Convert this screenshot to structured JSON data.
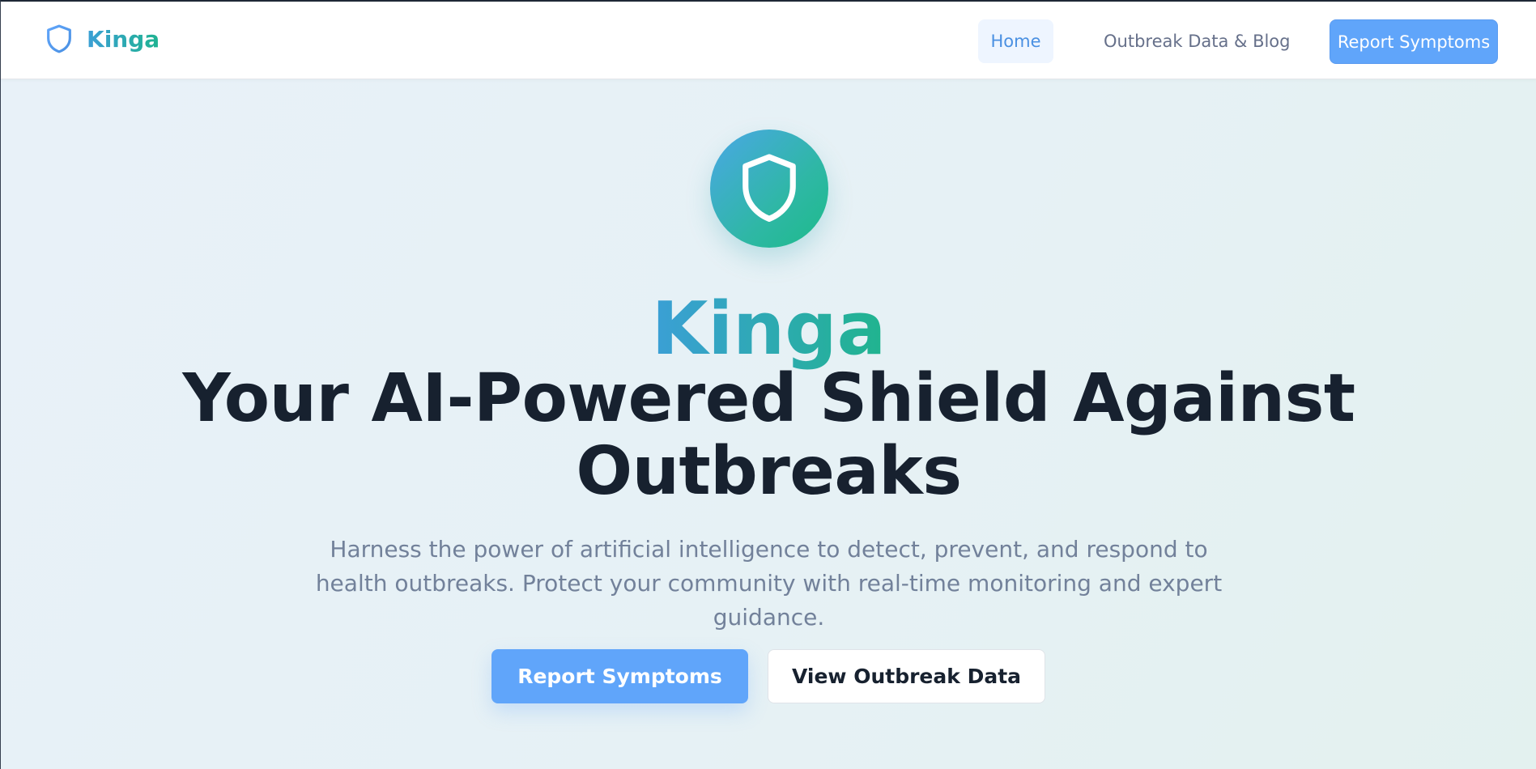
{
  "brand": {
    "name": "Kinga",
    "icon": "shield-icon"
  },
  "nav": {
    "home": "Home",
    "blog": "Outbreak Data & Blog",
    "report": "Report Symptoms"
  },
  "hero": {
    "badge_icon": "shield-icon",
    "brand": "Kinga",
    "title": "Your AI-Powered Shield Against Outbreaks",
    "subtitle": "Harness the power of artificial intelligence to detect, prevent, and respond to health outbreaks. Protect your community with real-time monitoring and expert guidance.",
    "primary_cta": "Report Symptoms",
    "secondary_cta": "View Outbreak Data"
  },
  "colors": {
    "accent": "#60a5fa",
    "brand_gradient_start": "#3b9fd6",
    "brand_gradient_end": "#20b48e",
    "heading": "#17212f",
    "muted": "#72819a"
  }
}
